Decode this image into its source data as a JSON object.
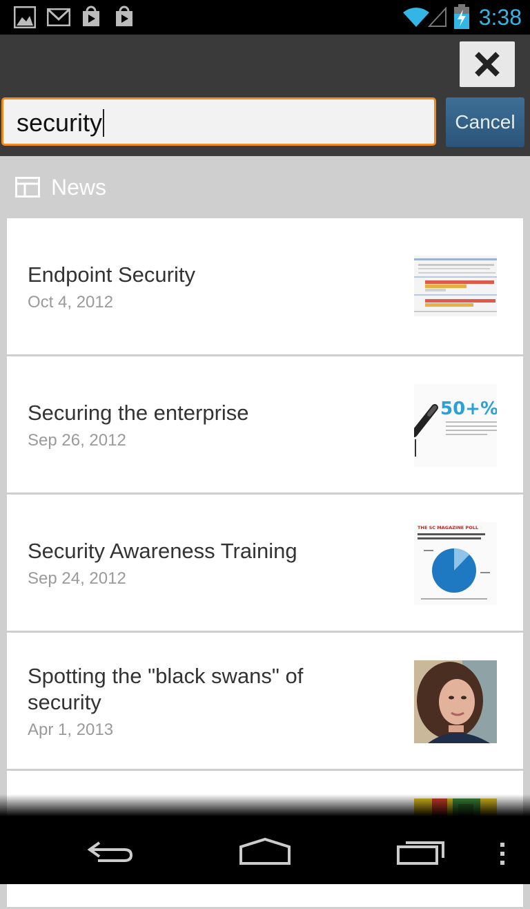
{
  "status_bar": {
    "time": "3:38",
    "notification_icons": [
      "gallery-icon",
      "gmail-icon",
      "play-store-icon",
      "shopping-bag-icon"
    ],
    "system_icons": [
      "wifi-icon",
      "signal-icon",
      "battery-charging-icon"
    ],
    "accent_color": "#33b5e5"
  },
  "search": {
    "query": "security",
    "cancel_label": "Cancel",
    "focus_color": "#f08a1c"
  },
  "section": {
    "title": "News",
    "icon": "news-icon"
  },
  "results": [
    {
      "title": "Endpoint Security",
      "date": "Oct 4, 2012",
      "thumb": "bar-chart-thumbnail"
    },
    {
      "title": "Securing the enterprise",
      "date": "Sep 26, 2012",
      "thumb": "pen-percentage-thumbnail",
      "thumb_text": "50+%"
    },
    {
      "title": "Security Awareness Training",
      "date": "Sep 24, 2012",
      "thumb": "pie-chart-poll-thumbnail",
      "thumb_text": "THE SC MAGAZINE POLL"
    },
    {
      "title": "Spotting the \"black swans\" of security",
      "date": "Apr 1, 2013",
      "thumb": "portrait-photo-thumbnail"
    },
    {
      "title": "",
      "date": "",
      "thumb": "colorful-thumbnail"
    }
  ],
  "nav_bar": {
    "icons": [
      "back-icon",
      "home-icon",
      "recent-apps-icon",
      "overflow-menu-icon"
    ]
  }
}
